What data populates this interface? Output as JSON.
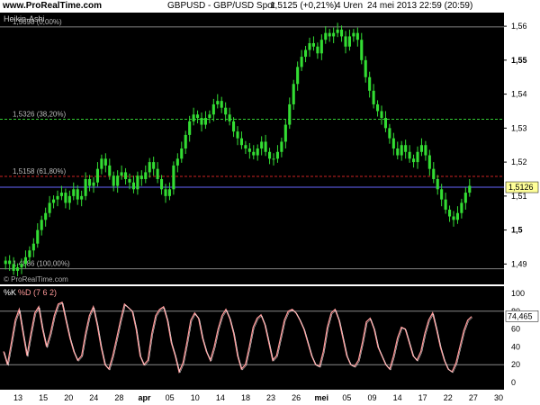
{
  "header": {
    "brand": "www.ProRealTime.com",
    "symbol": "GBPUSD - GBP/USD Spot",
    "price_change": "1,5125 (+0,21%)",
    "interval": "4 Uren",
    "datetime": "24 mei 2013 22:59 (20:59)"
  },
  "main_panel": {
    "indicator_label": "Heikin-Ashi",
    "watermark": "© ProRealTime.com",
    "fib_levels": [
      {
        "label": "1,5698 (0,00%)",
        "price": 1.5598,
        "color": "#808080",
        "style": "solid"
      },
      {
        "label": "1,5326 (38,20%)",
        "price": 1.5326,
        "color": "#33cc33",
        "style": "dashed"
      },
      {
        "label": "1,5158 (61,80%)",
        "price": 1.5158,
        "color": "#cc2222",
        "style": "dashed"
      },
      {
        "label": "1,4886 (100,00%)",
        "price": 1.4886,
        "color": "#808080",
        "style": "solid"
      }
    ],
    "current_price_label": "1,5126",
    "current_price": 1.5126,
    "price_axis_ticks": [
      "1,56",
      "1,55",
      "1,54",
      "1,53",
      "1,52",
      "1,51",
      "1,5",
      "1,49"
    ],
    "bold_ticks": [
      "1,55",
      "1,5"
    ],
    "candle_color": "#33dd33",
    "current_line_color": "#6666ff"
  },
  "oscillator": {
    "label_k": "%K",
    "label_d": "%D (7 6 2)",
    "current_value_label": "74,465",
    "axis_ticks": [
      "100",
      "80",
      "60",
      "40",
      "20",
      "0"
    ],
    "line_color": "#ff9999",
    "levels": [
      80,
      20
    ]
  },
  "x_axis": {
    "ticks": [
      "13",
      "15",
      "20",
      "24",
      "28",
      "apr",
      "05",
      "10",
      "14",
      "18",
      "23",
      "26",
      "mei",
      "05",
      "09",
      "14",
      "17",
      "22",
      "27",
      "30"
    ],
    "bold_ticks": [
      "apr",
      "mei"
    ]
  },
  "chart_data": {
    "type": "line",
    "title": "GBPUSD - GBP/USD Spot",
    "xlabel": "",
    "ylabel": "",
    "ylim": [
      1.484,
      1.564
    ],
    "series": [
      {
        "name": "Heikin-Ashi",
        "values": [
          1.491,
          1.49,
          1.488,
          1.489,
          1.49,
          1.492,
          1.494,
          1.496,
          1.5,
          1.503,
          1.505,
          1.508,
          1.509,
          1.51,
          1.511,
          1.508,
          1.51,
          1.512,
          1.509,
          1.51,
          1.515,
          1.513,
          1.514,
          1.518,
          1.521,
          1.519,
          1.516,
          1.513,
          1.516,
          1.517,
          1.515,
          1.514,
          1.512,
          1.516,
          1.515,
          1.517,
          1.52,
          1.518,
          1.515,
          1.512,
          1.51,
          1.512,
          1.519,
          1.521,
          1.524,
          1.528,
          1.532,
          1.534,
          1.533,
          1.531,
          1.533,
          1.534,
          1.537,
          1.538,
          1.536,
          1.534,
          1.532,
          1.529,
          1.527,
          1.525,
          1.524,
          1.523,
          1.522,
          1.524,
          1.526,
          1.523,
          1.521,
          1.521,
          1.523,
          1.526,
          1.531,
          1.537,
          1.543,
          1.548,
          1.551,
          1.553,
          1.555,
          1.554,
          1.552,
          1.556,
          1.558,
          1.557,
          1.558,
          1.559,
          1.557,
          1.554,
          1.557,
          1.558,
          1.556,
          1.55,
          1.545,
          1.541,
          1.537,
          1.535,
          1.533,
          1.53,
          1.527,
          1.524,
          1.522,
          1.525,
          1.523,
          1.521,
          1.52,
          1.523,
          1.525,
          1.522,
          1.518,
          1.515,
          1.512,
          1.509,
          1.506,
          1.504,
          1.503,
          1.505,
          1.508,
          1.511,
          1.513
        ]
      }
    ],
    "oscillator_series": {
      "name": "%K",
      "ylim": [
        0,
        100
      ],
      "values": [
        35,
        20,
        45,
        70,
        82,
        55,
        30,
        55,
        78,
        85,
        60,
        40,
        55,
        75,
        88,
        90,
        70,
        50,
        35,
        25,
        30,
        55,
        75,
        85,
        65,
        40,
        20,
        15,
        30,
        50,
        70,
        88,
        84,
        80,
        60,
        30,
        20,
        25,
        55,
        75,
        82,
        85,
        70,
        45,
        30,
        12,
        22,
        45,
        70,
        78,
        72,
        50,
        35,
        25,
        40,
        60,
        75,
        82,
        72,
        55,
        30,
        15,
        20,
        40,
        62,
        72,
        76,
        65,
        45,
        25,
        30,
        50,
        70,
        80,
        82,
        78,
        70,
        60,
        45,
        30,
        20,
        18,
        35,
        62,
        78,
        82,
        70,
        50,
        30,
        20,
        18,
        25,
        45,
        68,
        72,
        60,
        40,
        30,
        20,
        15,
        30,
        50,
        62,
        60,
        45,
        30,
        25,
        35,
        55,
        70,
        78,
        60,
        40,
        25,
        15,
        12,
        22,
        40,
        58,
        70,
        74
      ]
    },
    "oscillator_levels": [
      20,
      80
    ],
    "current_price": 1.5126,
    "current_oscillator": 74.465
  }
}
